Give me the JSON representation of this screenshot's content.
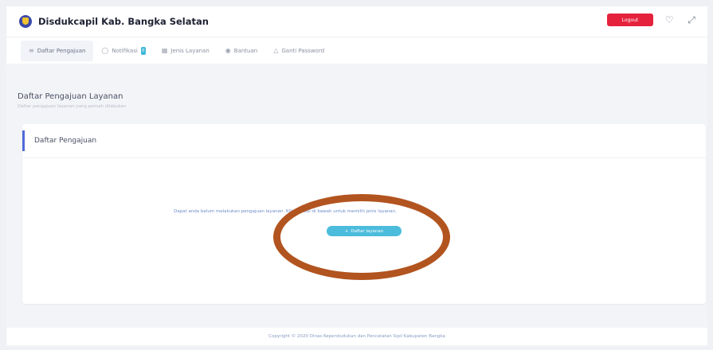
{
  "app": {
    "title": "Disdukcapil Kab. Bangka Selatan"
  },
  "header": {
    "logout_label": "Logout"
  },
  "menu": {
    "items": [
      {
        "label": "Daftar Pengajuan",
        "icon": "list-icon"
      },
      {
        "label": "Notifikasi",
        "icon": "bell-icon",
        "badge": "0"
      },
      {
        "label": "Jenis Layanan",
        "icon": "grid-icon"
      },
      {
        "label": "Bantuan",
        "icon": "help-icon"
      },
      {
        "label": "Ganti Password",
        "icon": "lock-icon"
      }
    ]
  },
  "page": {
    "title": "Daftar Pengajuan Layanan",
    "subtitle": "Daftar pengajuan layanan yang pernah dilakukan"
  },
  "card": {
    "title": "Daftar Pengajuan",
    "empty_message": "Dapat anda belum melakukan pengajuan layanan. Klik tombol di bawah untuk memilih jenis layanan.",
    "button_label": "Daftar layanan"
  },
  "footer": {
    "text": "Copyright © 2020 Dinas Kependudukan dan Pencatatan Sipil Kabupaten Bangka"
  },
  "colors": {
    "accent": "#4f6bd8",
    "button": "#4bbcdc",
    "logout": "#e5223c",
    "annotation": "#b2541f"
  }
}
